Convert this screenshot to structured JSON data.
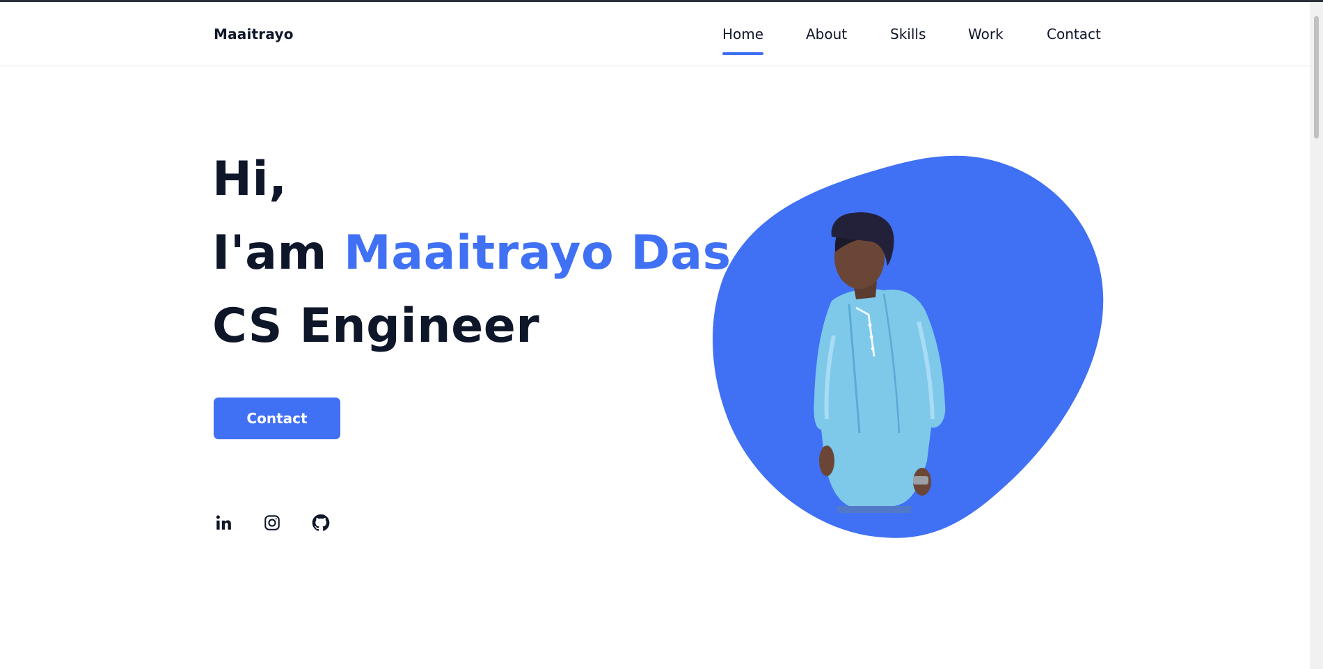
{
  "header": {
    "logo": "Maaitrayo",
    "nav": [
      {
        "label": "Home",
        "active": true
      },
      {
        "label": "About",
        "active": false
      },
      {
        "label": "Skills",
        "active": false
      },
      {
        "label": "Work",
        "active": false
      },
      {
        "label": "Contact",
        "active": false
      }
    ]
  },
  "hero": {
    "greeting": "Hi,",
    "intro_prefix": "I'am ",
    "name": "Maaitrayo Das",
    "role": "CS Engineer",
    "cta_label": "Contact",
    "social_icons": [
      "linkedin-icon",
      "instagram-icon",
      "github-icon"
    ],
    "photo_description": "portrait-photo"
  },
  "colors": {
    "accent": "#4070f4",
    "text": "#0e1629",
    "background": "#ffffff"
  }
}
